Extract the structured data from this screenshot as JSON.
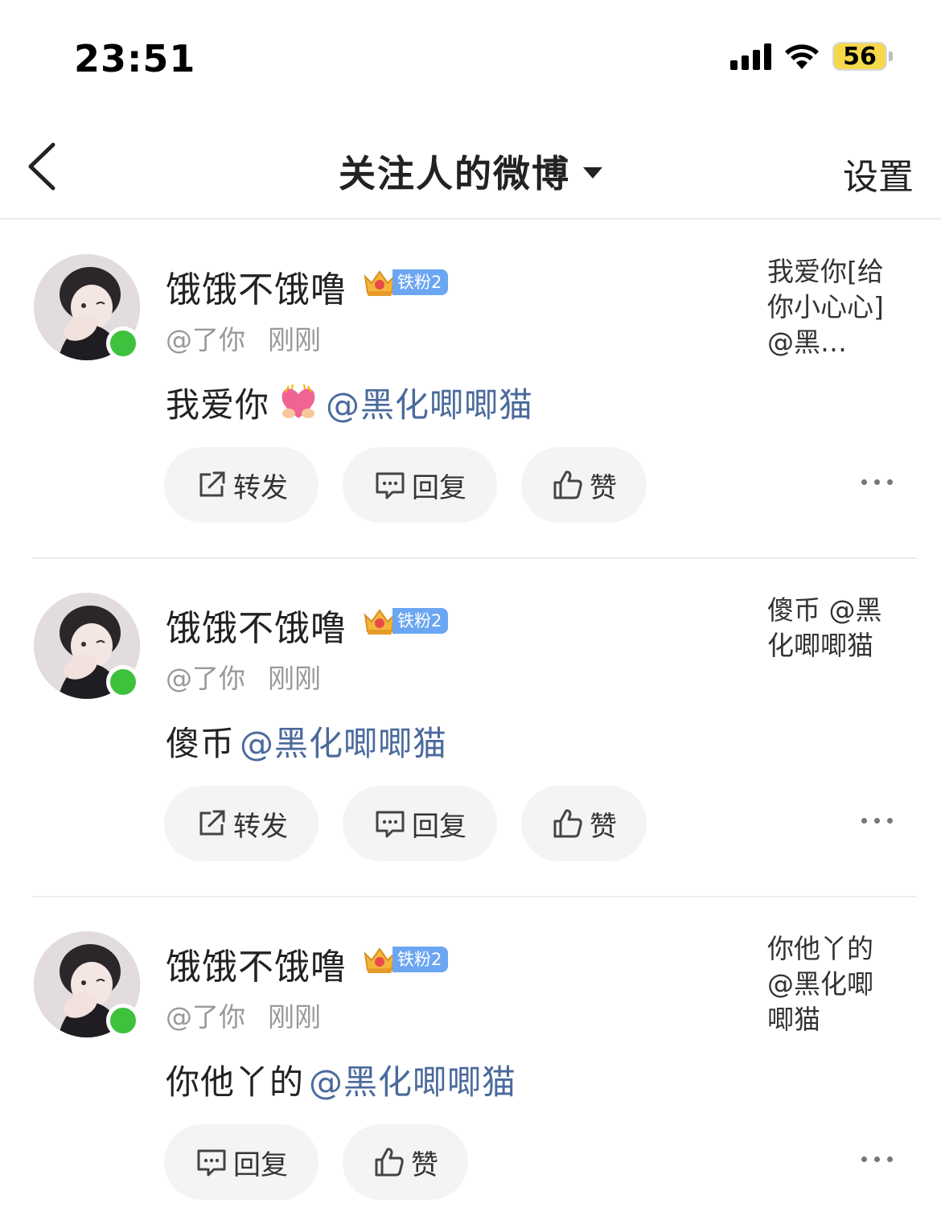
{
  "status_bar": {
    "time": "23:51",
    "battery": "56"
  },
  "nav": {
    "title": "关注人的微博",
    "settings_label": "设置"
  },
  "posts": [
    {
      "user_name": "饿饿不饿噜",
      "fan_badge": "铁粉2",
      "handle": "@了你",
      "time": "刚刚",
      "text": "我爱你",
      "has_heart_emoji": true,
      "mention": "@黑化唧唧猫",
      "source_snippet": "我爱你[给你小心心]@黑…",
      "actions": [
        "转发",
        "回复",
        "赞"
      ]
    },
    {
      "user_name": "饿饿不饿噜",
      "fan_badge": "铁粉2",
      "handle": "@了你",
      "time": "刚刚",
      "text": "傻币",
      "has_heart_emoji": false,
      "mention": "@黑化唧唧猫",
      "source_snippet": "傻币 @黑化唧唧猫",
      "actions": [
        "转发",
        "回复",
        "赞"
      ]
    },
    {
      "user_name": "饿饿不饿噜",
      "fan_badge": "铁粉2",
      "handle": "@了你",
      "time": "刚刚",
      "text": "你他丫的",
      "has_heart_emoji": false,
      "mention": "@黑化唧唧猫",
      "source_snippet": "你他丫的 @黑化唧唧猫",
      "actions": [
        "回复",
        "赞"
      ]
    }
  ],
  "colors": {
    "mention": "#4a6a9c",
    "online": "#3ec23e",
    "badge": "#6ba6f2",
    "battery": "#f5d94a"
  }
}
